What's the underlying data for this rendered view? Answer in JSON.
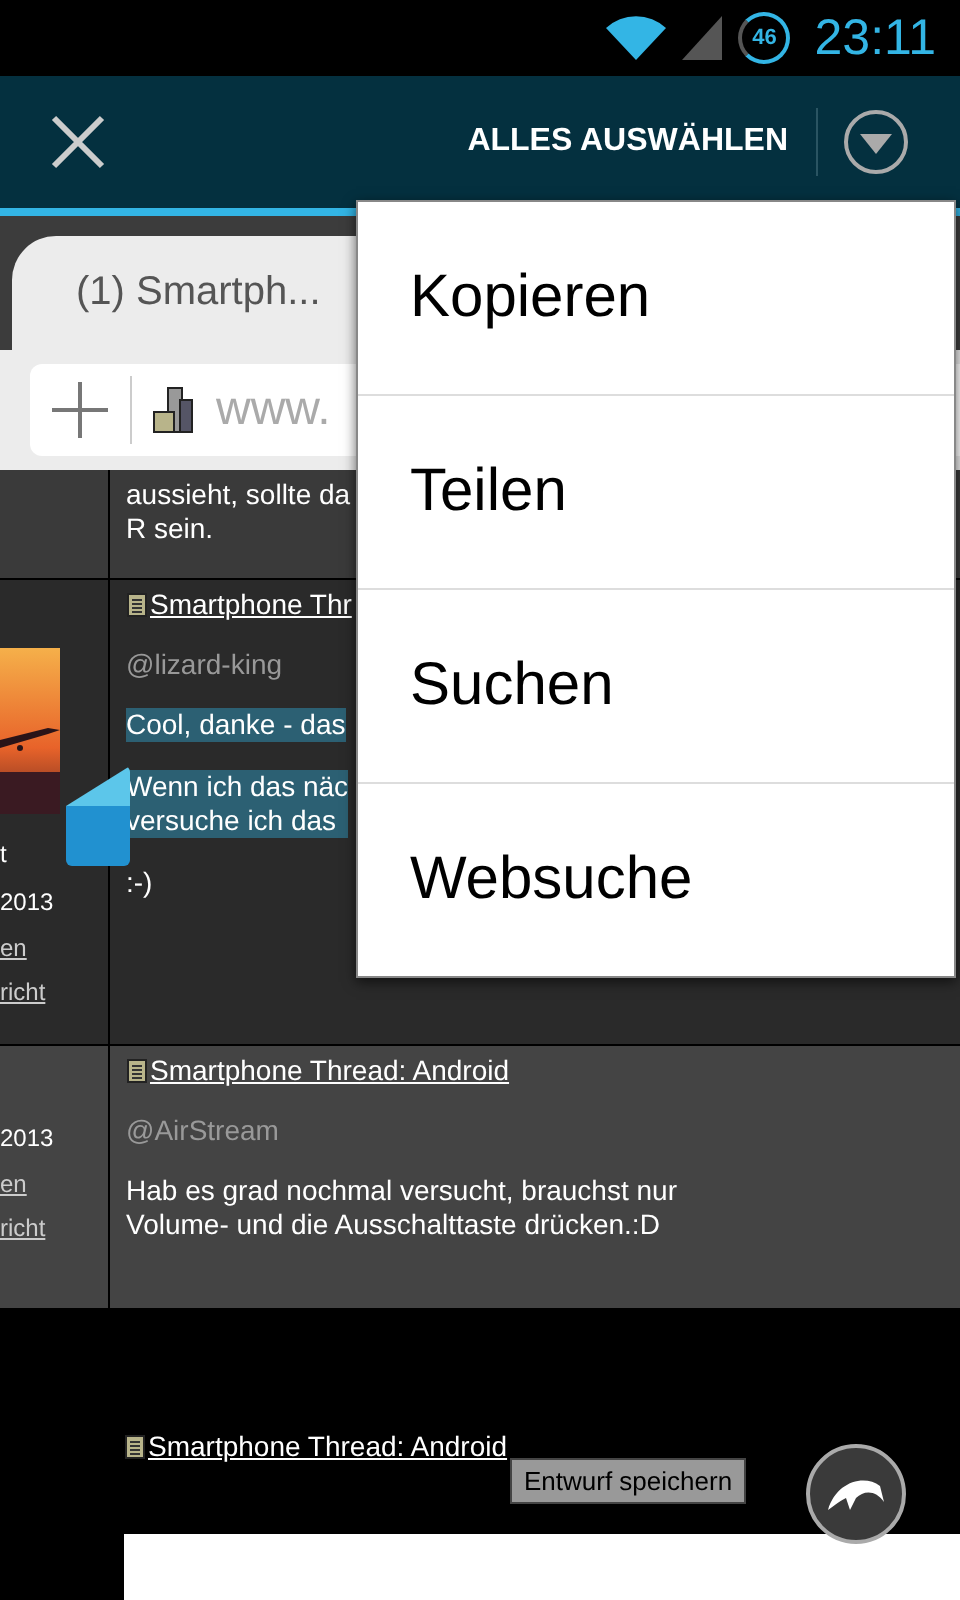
{
  "status_bar": {
    "battery": "46",
    "time": "23:11"
  },
  "action_bar": {
    "select_all": "ALLES AUSWÄHLEN"
  },
  "browser": {
    "tab_title": "(1) Smartph...",
    "url": "www."
  },
  "posts": [
    {
      "body": [
        {
          "lines": [
            "aussieht, sollte da",
            "R sein."
          ],
          "highlighted": false
        }
      ]
    },
    {
      "avatar": {
        "kind": "picture"
      },
      "author_lines": [
        "t",
        "2013"
      ],
      "links": [
        "en",
        "richt"
      ],
      "thread": "Smartphone Thr",
      "mention": "@lizard-king",
      "body": [
        {
          "lines": [
            "Cool, danke - das"
          ],
          "highlighted": true
        },
        {
          "lines": [
            "Wenn ich das näc",
            "versuche ich das"
          ],
          "highlighted": true
        },
        {
          "lines": [
            ":-)"
          ],
          "highlighted": false
        }
      ]
    },
    {
      "author_lines": [
        "2013"
      ],
      "links": [
        "en",
        "richt"
      ],
      "thread": "Smartphone Thread: Android",
      "mention": "@AirStream",
      "body": [
        {
          "lines": [
            "Hab es grad nochmal versucht, brauchst nur",
            "Volume- und die Ausschalttaste drücken.:D"
          ],
          "highlighted": false
        }
      ]
    }
  ],
  "footer": {
    "thread": "Smartphone Thread: Android",
    "save_button": "Entwurf speichern"
  },
  "menu": {
    "items": [
      "Kopieren",
      "Teilen",
      "Suchen",
      "Websuche"
    ]
  }
}
